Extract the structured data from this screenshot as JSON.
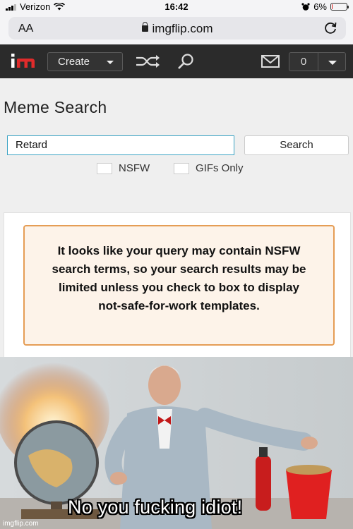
{
  "status_bar": {
    "carrier": "Verizon",
    "time": "16:42",
    "battery": "6%",
    "battery_level": 0.06,
    "icons": [
      "signal-icon",
      "wifi-icon",
      "alarm-icon",
      "battery-icon"
    ]
  },
  "browser": {
    "text_size_label": "AA",
    "url": "imgflip.com",
    "icons": [
      "lock-icon",
      "reload-icon"
    ]
  },
  "nav": {
    "logo_text": "im",
    "create_label": "Create",
    "notification_count": "0",
    "icons": [
      "shuffle-icon",
      "search-icon",
      "mail-icon",
      "chevron-down-icon"
    ],
    "colors": {
      "bar": "#2b2b2b",
      "logo_i": "#ffffff",
      "logo_m": "#e02b2b"
    }
  },
  "page": {
    "title": "Meme Search",
    "search_value": "Retard",
    "search_button": "Search",
    "checkbox_nsfw": "NSFW",
    "checkbox_gifs": "GIFs Only",
    "warning": "It looks like your query may contain NSFW search terms, so your search results may be limited unless you check to box to display not-safe-for-work templates.",
    "colors": {
      "input_border": "#3aa3c4",
      "warning_bg": "#fdf3e9",
      "warning_border": "#e59d55"
    }
  },
  "meme": {
    "caption": "No you fucking idiot!",
    "watermark": "imgflip.com"
  }
}
